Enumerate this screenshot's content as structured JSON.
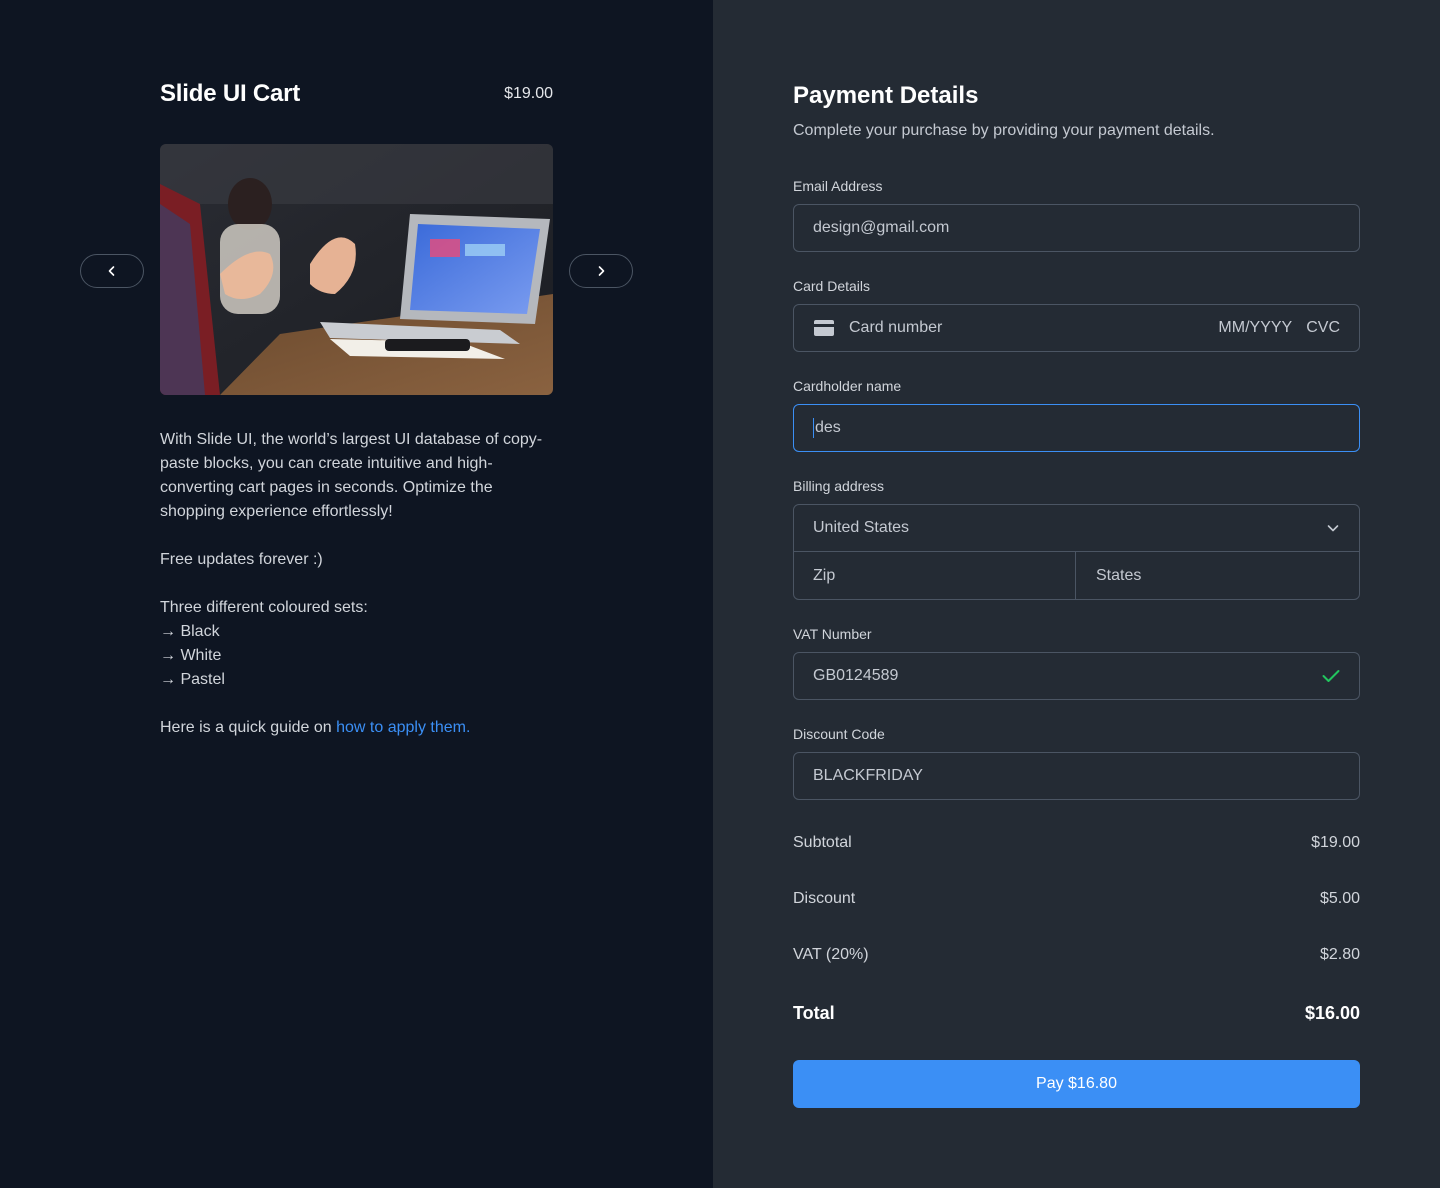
{
  "cart": {
    "title": "Slide UI Cart",
    "price": "$19.00",
    "description": "With Slide UI, the world’s largest UI database of copy-paste blocks, you can create intuitive and high-converting cart pages in seconds. Optimize the shopping experience effortlessly!",
    "free_updates": "Free updates forever :)",
    "sets_heading": "Three different coloured sets:",
    "sets": [
      "→ Black",
      "→ White",
      "→ Pastel"
    ],
    "guide_text": "Here is a quick guide on ",
    "guide_link": "how to apply them."
  },
  "payment": {
    "title": "Payment Details",
    "subtitle": "Complete your purchase by providing your payment details.",
    "email_label": "Email Address",
    "email_value": "design@gmail.com",
    "card_label": "Card Details",
    "card_number_placeholder": "Card number",
    "card_expiry_placeholder": "MM/YYYY",
    "card_cvc_placeholder": "CVC",
    "cardholder_label": "Cardholder name",
    "cardholder_value": "des",
    "billing_label": "Billing address",
    "country_value": "United States",
    "zip_placeholder": "Zip",
    "state_placeholder": "States",
    "vat_label": "VAT Number",
    "vat_value": "GB0124589",
    "discount_label": "Discount Code",
    "discount_value": "BLACKFRIDAY"
  },
  "summary": {
    "subtotal_label": "Subtotal",
    "subtotal_value": "$19.00",
    "discount_label": "Discount",
    "discount_value": "$5.00",
    "vat_label": "VAT (20%)",
    "vat_value": "$2.80",
    "total_label": "Total",
    "total_value": "$16.00"
  },
  "pay_button": "Pay $16.80",
  "colors": {
    "accent": "#3b8ff5",
    "left_bg": "#0e1522",
    "right_bg": "#242b34",
    "check": "#22c55e"
  },
  "icons": [
    "chevron-left-icon",
    "chevron-right-icon",
    "credit-card-icon",
    "chevron-down-icon",
    "check-icon"
  ]
}
